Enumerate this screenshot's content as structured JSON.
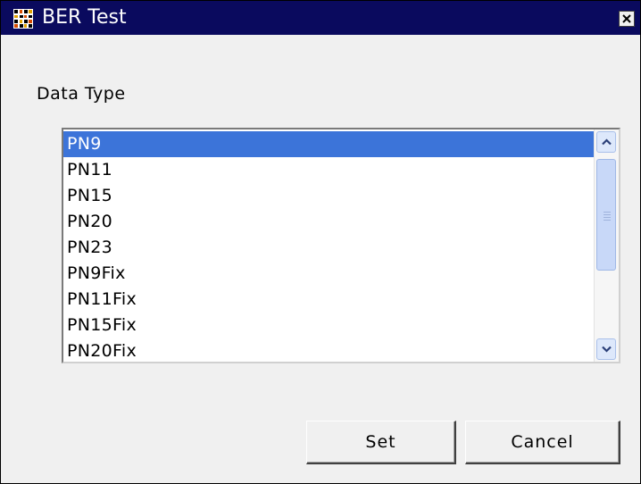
{
  "window": {
    "title": "BER Test",
    "close_icon": "close-icon",
    "app_icon": "ber-test-app-icon"
  },
  "data_type": {
    "label": "Data Type",
    "selected": "PN9",
    "options": [
      "PN9",
      "PN11",
      "PN15",
      "PN20",
      "PN23",
      "PN9Fix",
      "PN11Fix",
      "PN15Fix",
      "PN20Fix"
    ]
  },
  "buttons": {
    "set_label": "Set",
    "cancel_label": "Cancel"
  },
  "colors": {
    "titlebar": "#0a0a5e",
    "selection": "#3c74d9",
    "dialog_bg": "#f0f0f0"
  }
}
